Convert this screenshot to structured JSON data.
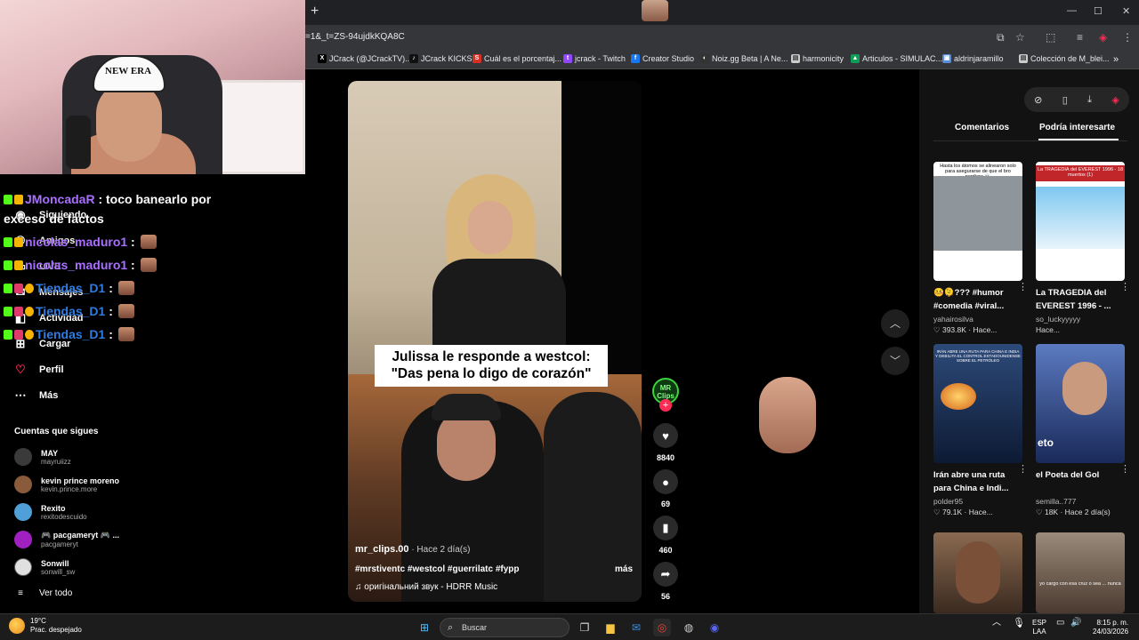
{
  "browser": {
    "new_tab": "+",
    "url": "=1&_t=ZS-94ujdkKQA8C",
    "window_controls": [
      "—",
      "☐",
      "✕"
    ],
    "bookmarks": [
      {
        "label": "JCrack (@JCrackTV)...",
        "icon": "x-logo",
        "icon_text": "X"
      },
      {
        "label": "JCrack KICKS",
        "icon": "tiktok-logo",
        "icon_text": "♪"
      },
      {
        "label": "Cuál es el porcentaj...",
        "icon": "s-logo",
        "icon_text": "S"
      },
      {
        "label": "jcrack - Twitch",
        "icon": "twitch-logo",
        "icon_text": "t"
      },
      {
        "label": "Creator Studio",
        "icon": "facebook-logo",
        "icon_text": "f"
      },
      {
        "label": "Noiz.gg Beta | A Ne...",
        "icon": "noiz-logo",
        "icon_text": "◐"
      },
      {
        "label": "harmonicity",
        "icon": "file-icon",
        "icon_text": "▤"
      },
      {
        "label": "Articulos - SIMULAC...",
        "icon": "drive-logo",
        "icon_text": "▲"
      },
      {
        "label": "aldrinjaramillo",
        "icon": "image-icon",
        "icon_text": "▣"
      },
      {
        "label": "Colección de M_blei...",
        "icon": "file-icon",
        "icon_text": "▤"
      }
    ]
  },
  "leftnav": {
    "items": [
      {
        "label": "Siguiendo",
        "icon": "following-icon"
      },
      {
        "label": "Amigos",
        "icon": "friends-icon"
      },
      {
        "label": "LIVE",
        "icon": "live-icon"
      },
      {
        "label": "Mensajes",
        "icon": "messages-icon"
      },
      {
        "label": "Actividad",
        "icon": "activity-icon"
      },
      {
        "label": "Cargar",
        "icon": "upload-icon"
      },
      {
        "label": "Perfil",
        "icon": "profile-icon"
      },
      {
        "label": "Más",
        "icon": "more-icon"
      }
    ],
    "following_title": "Cuentas que sigues",
    "accounts": [
      {
        "name": "MAY",
        "handle": "mayruiizz",
        "color": "#3a3a3a"
      },
      {
        "name": "kevin prince moreno",
        "handle": "kevin.prince.more",
        "color": "#8a5b3a"
      },
      {
        "name": "Rexito",
        "handle": "rexitodescuido",
        "color": "#4fa0d8"
      },
      {
        "name": "🎮 pacgameryt 🎮 ...",
        "handle": "pacgameryt",
        "color": "#a020c0"
      },
      {
        "name": "Sonwill",
        "handle": "sonwill_sw",
        "color": "#e0e0e0"
      }
    ],
    "see_all": "Ver todo"
  },
  "chat": [
    {
      "user": "JMoncadaR",
      "message": ": toco banearlo por",
      "color": "purple"
    },
    {
      "user": "",
      "message": "exceso de factos",
      "color": "white"
    },
    {
      "user": "nicolas_maduro1",
      "message": ":",
      "color": "purple"
    },
    {
      "user": "nicolas_maduro1",
      "message": ":",
      "color": "purple"
    },
    {
      "user": "Tiendas_D1",
      "message": ":",
      "color": "blue"
    },
    {
      "user": "Tiendas_D1",
      "message": ":",
      "color": "blue"
    },
    {
      "user": "Tiendas_D1",
      "message": ":",
      "color": "blue"
    }
  ],
  "cam": {
    "cap_text": "NEW ERA"
  },
  "video": {
    "caption_line1": "Julissa le responde a westcol:",
    "caption_line2": "\"Das pena lo digo de corazón\"",
    "author": "mr_clips.00",
    "posted": " · Hace 2 día(s)",
    "tags": "#mrstiventc #westcol #guerrilatc #fypp",
    "more": "más",
    "music": "оригінальний звук - HDRR Music",
    "avatar_text": "MR Clips",
    "likes": "8840",
    "comments": "69",
    "saves": "460",
    "shares": "56"
  },
  "rightpanel": {
    "tabs": [
      "Comentarios",
      "Podría interesarte"
    ],
    "active_tab": 1,
    "cards": [
      {
        "title": "🤒🫠??? #humor #comedia #viral...",
        "user": "yahairosilva",
        "stats": "♡ 393.8K · Hace...",
        "thumb_text": "Hasta los átomos se alinearon solo para asegurarse de que el bro perdiera 💀",
        "bg": "#9aa0a6"
      },
      {
        "title": "La TRAGEDIA del EVEREST 1996 - ...",
        "user": "so_luckyyyyy",
        "stats": "Hace...",
        "thumb_text": "La TRAGEDIA del EVEREST 1996 - 18 muertos (1)",
        "bg": "#ffffff"
      },
      {
        "title": "Irán abre una ruta para China e Indi...",
        "user": "polder95",
        "stats": "♡ 79.1K · Hace...",
        "thumb_text": "IRÁN ABRE UNA RUTA PARA CHINA E INDIA Y DEBILITA EL CONTROL ESTADOUNIDENSE SOBRE EL PETRÓLEO",
        "bg": "#2d4a7a"
      },
      {
        "title": "el Poeta del Gol",
        "user": "semilla..777",
        "stats": "♡ 18K · Hace 2 día(s)",
        "thumb_text": "eto",
        "bg": "#3a5a9a"
      },
      {
        "title": "",
        "user": "",
        "stats": "",
        "thumb_text": "",
        "bg": "#6b4a36"
      },
      {
        "title": "",
        "user": "",
        "stats": "",
        "thumb_text": "yo cargo con esa cruz o sea ... nunca",
        "bg": "#7a6a5a"
      }
    ]
  },
  "taskbar": {
    "temp": "19°C",
    "weather": "Prac. despejado",
    "search": "Buscar",
    "lang1": "ESP",
    "lang2": "LAA",
    "time": "8:15 p. m.",
    "date": "24/03/2026"
  }
}
